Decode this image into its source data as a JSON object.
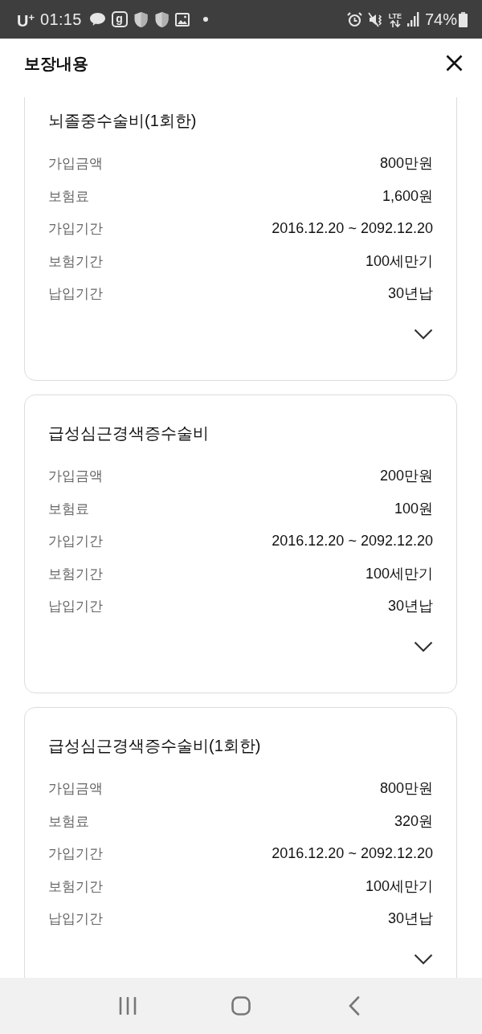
{
  "status_bar": {
    "carrier": "U$^{+}$",
    "time": "01:15",
    "app_badge": "g",
    "network": "LTE",
    "battery": "74%"
  },
  "header": {
    "title": "보장내용"
  },
  "cards": [
    {
      "title": "뇌졸중수술비(1회한)",
      "expanded": false,
      "rows": [
        {
          "label": "가입금액",
          "value": "800만원"
        },
        {
          "label": "보험료",
          "value": "1,600원"
        },
        {
          "label": "가입기간",
          "value": "2016.12.20 ~ 2092.12.20"
        },
        {
          "label": "보험기간",
          "value": "100세만기"
        },
        {
          "label": "납입기간",
          "value": "30년납"
        }
      ]
    },
    {
      "title": "급성심근경색증수술비",
      "expanded": false,
      "rows": [
        {
          "label": "가입금액",
          "value": "200만원"
        },
        {
          "label": "보험료",
          "value": "100원"
        },
        {
          "label": "가입기간",
          "value": "2016.12.20 ~ 2092.12.20"
        },
        {
          "label": "보험기간",
          "value": "100세만기"
        },
        {
          "label": "납입기간",
          "value": "30년납"
        }
      ]
    },
    {
      "title": "급성심근경색증수술비(1회한)",
      "expanded": false,
      "rows": [
        {
          "label": "가입금액",
          "value": "800만원"
        },
        {
          "label": "보험료",
          "value": "320원"
        },
        {
          "label": "가입기간",
          "value": "2016.12.20 ~ 2092.12.20"
        },
        {
          "label": "보험기간",
          "value": "100세만기"
        },
        {
          "label": "납입기간",
          "value": "30년납"
        }
      ]
    }
  ]
}
